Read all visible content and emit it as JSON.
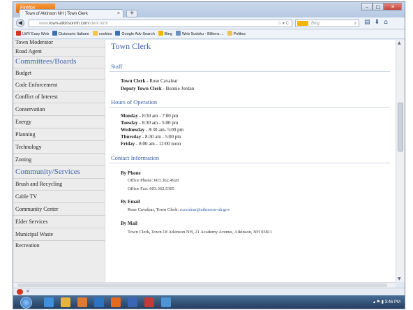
{
  "browser": {
    "menu_button": "Firefox",
    "tab_title": "Town of Atkinson NH | Town Clerk",
    "tab_close": "×",
    "new_tab": "+",
    "window_controls": {
      "minimize": "–",
      "maximize": "□",
      "close": "✕"
    },
    "url_prefix": "www.",
    "url_domain": "town-atkinsonnh.com",
    "url_path": "/clerk.html",
    "url_icons": "☆ ▾ C",
    "search_placeholder": "Bing",
    "bookmarks": [
      {
        "label": "LWV Easy Web",
        "color": "#d4351e"
      },
      {
        "label": "Dizionario Italiano",
        "color": "#3b6fb6"
      },
      {
        "label": "cookies",
        "color": "#f7c34a"
      },
      {
        "label": "Google Adv Search",
        "color": "#3b6fb6"
      },
      {
        "label": "Bing",
        "color": "#f4b400"
      },
      {
        "label": "Web Sudoku - Billions ...",
        "color": "#6d8fc0"
      },
      {
        "label": "Politics",
        "color": "#f0c350"
      }
    ]
  },
  "sidebar": {
    "items_top": [
      "Town Moderator",
      "Road Agent"
    ],
    "heading_committees": "Committees/Boards",
    "committees": [
      "Budget",
      "Code Enforcement",
      "Conflict of Interest",
      "Conservation",
      "Energy",
      "Planning",
      "Technology",
      "Zoning"
    ],
    "heading_services": "Community/Services",
    "services": [
      "Brush and Recycling",
      "Cable TV",
      "Community Center",
      "Elder Services",
      "Municipal Waste",
      "Recreation"
    ]
  },
  "content": {
    "title": "Town Clerk",
    "staff_heading": "Staff",
    "staff": [
      {
        "role": "Town Clerk",
        "sep": " - ",
        "name": "Rose Cavalear"
      },
      {
        "role": "Deputy Town Clerk",
        "sep": " - ",
        "name": "Bonnie Jordan"
      }
    ],
    "hours_heading": "Hours of Operation",
    "hours": [
      {
        "day": "Monday",
        "sep": " - ",
        "time": "8:30 am - 7:00 pm"
      },
      {
        "day": "Tuesday",
        "sep": " - ",
        "time": "8:30 am - 5:00 pm"
      },
      {
        "day": "Wednesday",
        "sep": " - ",
        "time": "8:30 am- 5:00 pm"
      },
      {
        "day": "Thursday",
        "sep": " - ",
        "time": "8:30 am - 5:00 pm"
      },
      {
        "day": "Friday",
        "sep": " - ",
        "time": "8:00 am - 12:00 noon"
      }
    ],
    "contact_heading": "Contact Information",
    "by_phone": "By Phone",
    "office_phone": "Office Phone: 603.362.4920",
    "office_fax": "Office Fax: 603.362.5305",
    "by_email": "By Email",
    "email_label": "Rose Cavalear, Town Clerk:",
    "email_link": "rcavalear@atkinson-nh.gov",
    "by_mail": "By Mail",
    "mail_address": "Town Clerk, Town Of Atkinson NH, 21 Academy Avenue, Atkinson, NH 03811"
  },
  "statusbar": {
    "close": "×"
  },
  "taskbar": {
    "icons": [
      {
        "name": "ie",
        "color": "#3f8fdc"
      },
      {
        "name": "explorer",
        "color": "#e6b33b"
      },
      {
        "name": "media",
        "color": "#e07a2e"
      },
      {
        "name": "outlook",
        "color": "#2d73c4"
      },
      {
        "name": "firefox",
        "color": "#e56a1e"
      },
      {
        "name": "word",
        "color": "#3c66b5"
      },
      {
        "name": "app",
        "color": "#c33b36"
      },
      {
        "name": "app2",
        "color": "#4f94d4"
      }
    ],
    "clock": "3:46 PM"
  }
}
